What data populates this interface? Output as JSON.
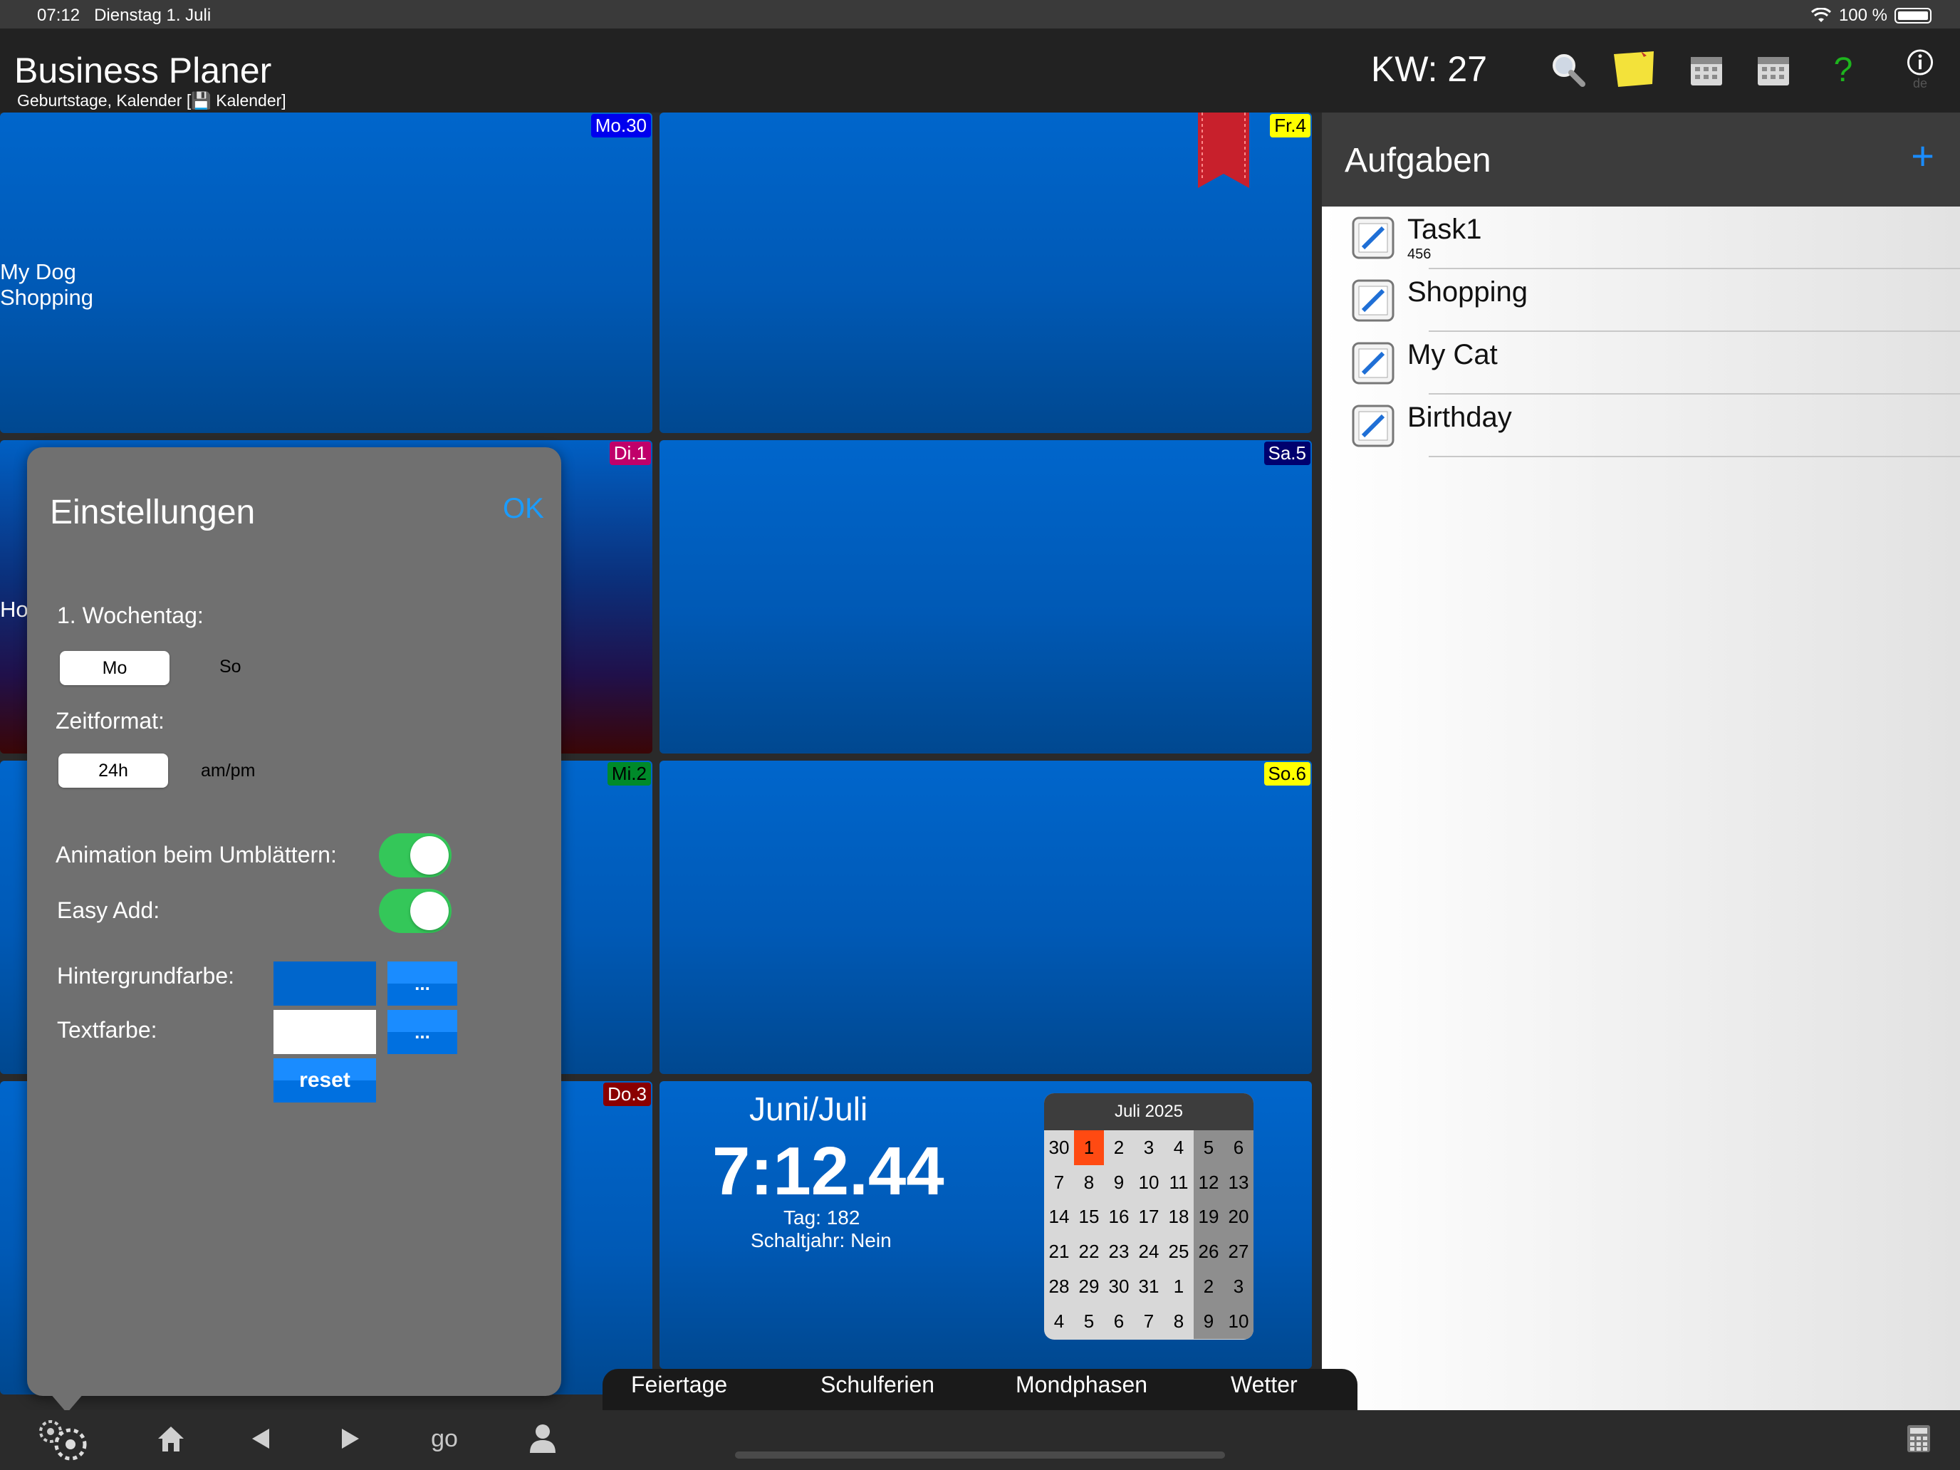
{
  "status_bar": {
    "time": "07:12",
    "date": "Dienstag 1. Juli",
    "battery": "100 %"
  },
  "nav": {
    "title": "Business Planer",
    "subtitle": "Geburtstage, Kalender [💾 Kalender]",
    "week": "KW: 27",
    "icons": [
      "search-icon",
      "sticky-note-icon",
      "calendar-icon",
      "calendar-icon",
      "help-icon",
      "info-icon"
    ],
    "help_label": "?",
    "info_sub": "de"
  },
  "days": {
    "mon": {
      "label": "Mo.30",
      "events": [
        "My Dog",
        "Shopping"
      ],
      "label_bg": "#0000ee",
      "label_color": "#ffffff"
    },
    "tue": {
      "label": "Di.1",
      "events": [
        "Ho"
      ],
      "label_bg": "#c0006a",
      "label_color": "#ffffff"
    },
    "wed": {
      "label": "Mi.2",
      "label_bg": "#008a2a",
      "label_color": "#000000"
    },
    "thu": {
      "label": "Do.3",
      "label_bg": "#8a0000",
      "label_color": "#ffffff"
    },
    "fri": {
      "label": "Fr.4",
      "label_bg": "#ffff00",
      "label_color": "#000000"
    },
    "sat": {
      "label": "Sa.5",
      "label_bg": "#00006e",
      "label_color": "#ffffff"
    },
    "sun": {
      "label": "So.6",
      "label_bg": "#ffff00",
      "label_color": "#000000"
    }
  },
  "tasks": {
    "title": "Aufgaben",
    "add_label": "+",
    "items": [
      {
        "label": "Task1",
        "sub": "456"
      },
      {
        "label": "Shopping"
      },
      {
        "label": "My Cat"
      },
      {
        "label": "Birthday"
      }
    ]
  },
  "settings": {
    "title": "Einstellungen",
    "ok": "OK",
    "weekday_label": "1. Wochentag:",
    "weekday_selected": "Mo",
    "weekday_other": "So",
    "timeformat_label": "Zeitformat:",
    "timeformat_selected": "24h",
    "timeformat_other": "am/pm",
    "animation_label": "Animation beim Umblättern:",
    "animation_on": true,
    "easyadd_label": "Easy Add:",
    "easyadd_on": true,
    "bgcolor_label": "Hintergrundfarbe:",
    "bgcolor_value": "#0066cc",
    "textcolor_label": "Textfarbe:",
    "textcolor_value": "#ffffff",
    "dots": "...",
    "reset": "reset"
  },
  "clock": {
    "month": "Juni/Juli",
    "time": "7:12.44",
    "day": "Tag: 182",
    "leap": "Schaltjahr: Nein"
  },
  "mini_calendar": {
    "title": "Juli 2025",
    "weeks": [
      [
        "30",
        "1",
        "2",
        "3",
        "4",
        "5",
        "6"
      ],
      [
        "7",
        "8",
        "9",
        "10",
        "11",
        "12",
        "13"
      ],
      [
        "14",
        "15",
        "16",
        "17",
        "18",
        "19",
        "20"
      ],
      [
        "21",
        "22",
        "23",
        "24",
        "25",
        "26",
        "27"
      ],
      [
        "28",
        "29",
        "30",
        "31",
        "1",
        "2",
        "3"
      ],
      [
        "4",
        "5",
        "6",
        "7",
        "8",
        "9",
        "10"
      ]
    ],
    "today": "1"
  },
  "bottom_tabs": [
    "Feiertage",
    "Schulferien",
    "Mondphasen",
    "Wetter"
  ],
  "toolbar": {
    "icons": [
      "settings-gears-icon",
      "home-icon",
      "previous-icon",
      "next-icon",
      "go-button",
      "person-icon",
      "calculator-icon"
    ],
    "go_label": "go"
  },
  "colors": {
    "accent": "#1a8cff",
    "toggle_on": "#34c759",
    "tile_blue": "#0066cc",
    "today": "#ff4a12"
  }
}
